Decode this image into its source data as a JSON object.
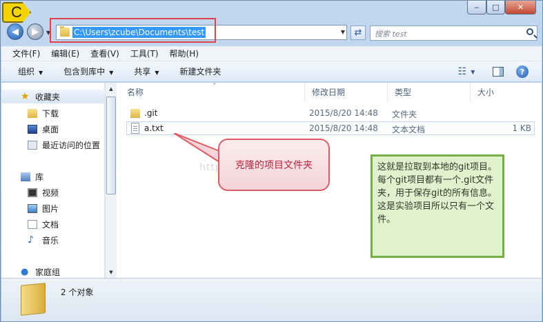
{
  "annotation_badge": "C",
  "window_controls": {
    "minimize": "‒",
    "maximize": "□",
    "close": "✕"
  },
  "navigation": {
    "back_glyph": "◀",
    "forward_glyph": "▶",
    "refresh_glyph": "⇄",
    "dropdown_glyph": "▼"
  },
  "address_bar": {
    "path": "C:\\Users\\zcube\\Documents\\test"
  },
  "search": {
    "placeholder": "搜索 test"
  },
  "menubar": [
    "文件(F)",
    "编辑(E)",
    "查看(V)",
    "工具(T)",
    "帮助(H)"
  ],
  "toolbar": {
    "organize": "组织",
    "include_in_library": "包含到库中",
    "share": "共享",
    "new_folder": "新建文件夹",
    "view_glyph": "☷",
    "help_glyph": "?"
  },
  "sidebar": {
    "favorites": "收藏夹",
    "downloads": "下载",
    "desktop": "桌面",
    "recent_places": "最近访问的位置",
    "libraries": "库",
    "videos": "视频",
    "pictures": "图片",
    "documents": "文档",
    "music": "音乐",
    "homegroup": "家庭组"
  },
  "columns": {
    "name": "名称",
    "date_modified": "修改日期",
    "type": "类型",
    "size": "大小"
  },
  "files": [
    {
      "name": ".git",
      "date": "2015/8/20 14:48",
      "type": "文件夹",
      "size": ""
    },
    {
      "name": "a.txt",
      "date": "2015/8/20 14:48",
      "type": "文本文档",
      "size": "1 KB"
    }
  ],
  "watermark": "http://blog.csdn.net/",
  "callout": "克隆的项目文件夹",
  "note": "这就是拉取到本地的git项目。每个git项目都有一个.git文件夹，用于保存git的所有信息。这是实验项目所以只有一个文件。",
  "status": {
    "item_count": "2 个对象"
  },
  "colors": {
    "highlight_border": "#e0424b",
    "note_border": "#74b043",
    "callout_text": "#c0203a",
    "selection": "#3399ff"
  }
}
